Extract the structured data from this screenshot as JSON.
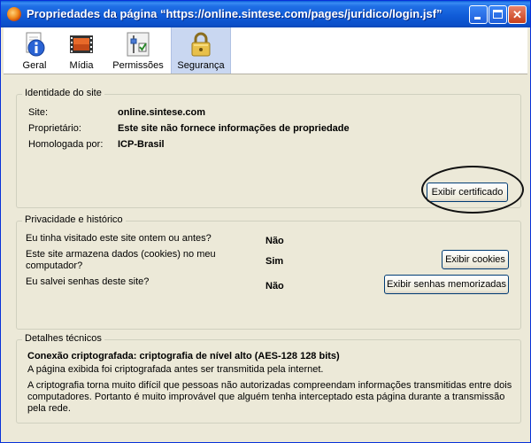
{
  "window": {
    "title": "Propriedades da página “https://online.sintese.com/pages/juridico/login.jsf”",
    "controls": {
      "minimize": "minimize",
      "maximize": "maximize",
      "close": "✕"
    }
  },
  "tabs": [
    {
      "label": "Geral",
      "icon": "info-icon",
      "selected": false
    },
    {
      "label": "Mídia",
      "icon": "media-icon",
      "selected": false
    },
    {
      "label": "Permissões",
      "icon": "permissions-icon",
      "selected": false
    },
    {
      "label": "Segurança",
      "icon": "padlock-icon",
      "selected": true
    }
  ],
  "identity": {
    "title": "Identidade do site",
    "site_label": "Site:",
    "site_value": "online.sintese.com",
    "owner_label": "Proprietário:",
    "owner_value": "Este site não fornece informações de propriedade",
    "verified_label": "Homologada por:",
    "verified_value": "ICP-Brasil",
    "view_cert_button": "Exibir certificado"
  },
  "privacy": {
    "title": "Privacidade e histórico",
    "q1": "Eu tinha visitado este site ontem ou antes?",
    "a1": "Não",
    "q2_line1": "Este site armazena dados (cookies) no meu",
    "q2_line2": "computador?",
    "a2": "Sim",
    "cookies_button": "Exibir cookies",
    "q3": "Eu salvei senhas deste site?",
    "a3": "Não",
    "passwords_button": "Exibir senhas memorizadas"
  },
  "technical": {
    "title": "Detalhes técnicos",
    "headline": "Conexão criptografada: criptografia de nível alto (AES-128 128 bits)",
    "line1": "A página exibida foi criptografada antes ser transmitida pela internet.",
    "para_line1": "A criptografia torna muito difícil que pessoas não autorizadas compreendam informações transmitidas entre dois",
    "para_line2": "computadores. Portanto é muito improvável que alguém tenha interceptado esta página durante a transmissão",
    "para_line3": "pela rede."
  },
  "colors": {
    "titlebar": "#0b4fc9",
    "selected_tab": "#c9d7f1",
    "dialog_bg": "#ece9d8"
  }
}
